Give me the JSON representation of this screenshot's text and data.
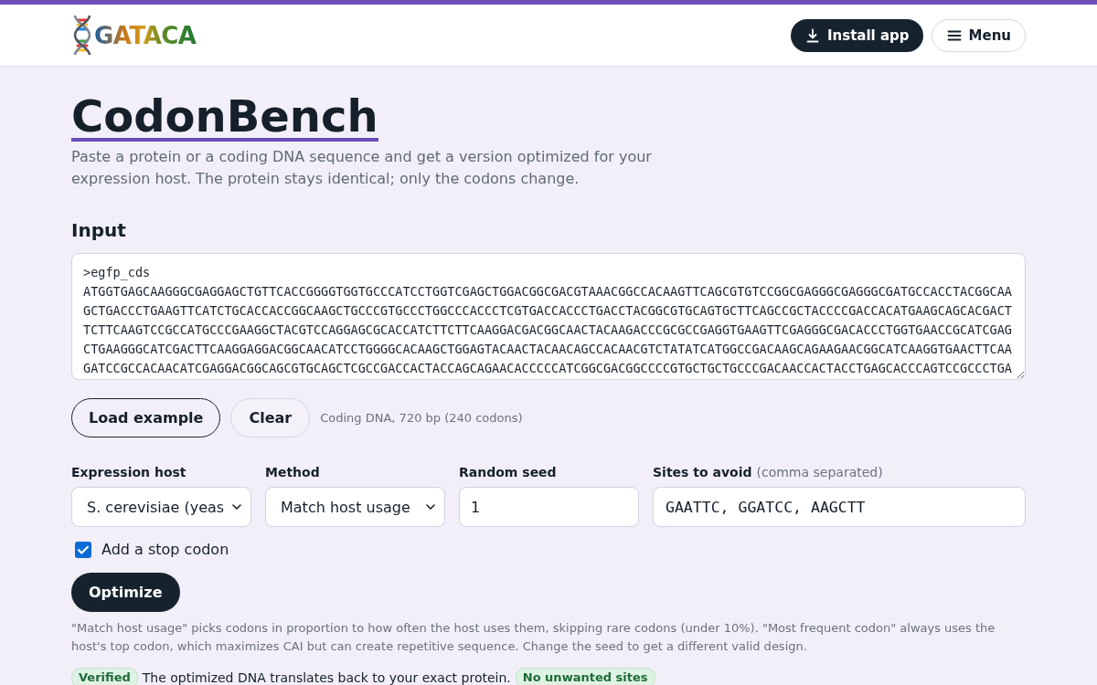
{
  "header": {
    "logo_text": "GATACA",
    "actions": [
      {
        "kind": "install",
        "label": "Install app"
      },
      {
        "kind": "menu",
        "label": "Menu"
      }
    ]
  },
  "title": "CodonBench",
  "intro": "Paste a protein or a coding DNA sequence and get a version optimized for your expression host. The protein stays identical; only the codons change.",
  "input": {
    "heading": "Input",
    "value": ">egfp_cds\nATGGTGAGCAAGGGCGAGGAGCTGTTCACCGGGGTGGTGCCCATCCTGGTCGAGCTGGACGGCGACGTAAACGGCCACAAGTTCAGCGTGTCCGGCGAGGGCGAGGGCGATGCCACCTACGGCAA\nGCTGACCCTGAAGTTCATCTGCACCACCGGCAAGCTGCCCGTGCCCTGGCCCACCCTCGTGACCACCCTGACCTACGGCGTGCAGTGCTTCAGCCGCTACCCCGACCACATGAAGCAGCACGACT\nTCTTCAAGTCCGCCATGCCCGAAGGCTACGTCCAGGAGCGCACCATCTTCTTCAAGGACGACGGCAACTACAAGACCCGCGCCGAGGTGAAGTTCGAGGGCGACACCCTGGTGAACCGCATCGAG\nCTGAAGGGCATCGACTTCAAGGAGGACGGCAACATCCTGGGGCACAAGCTGGAGTACAACTACAACAGCCACAACGTCTATATCATGGCCGACAAGCAGAAGAACGGCATCAAGGTGAACTTCAA\nGATCCGCCACAACATCGAGGACGGCAGCGTGCAGCTCGCCGACCACTACCAGCAGAACACCCCCATCGGCGACGGCCCCGTGCTGCTGCCCGACAACCACTACCTGAGCACCCAGTCCGCCCTGA",
    "buttons": [
      {
        "kind": "outline",
        "label": "Load example"
      },
      {
        "kind": "soft",
        "label": "Clear"
      }
    ],
    "status": "Coding DNA, 720 bp (240 codons)"
  },
  "settings": {
    "fields": [
      {
        "kind": "select",
        "label": "Expression host",
        "value": "S. cerevisiae (yeas"
      },
      {
        "kind": "select",
        "label": "Method",
        "value": "Match host usage"
      },
      {
        "kind": "number",
        "label": "Random seed",
        "value": "1"
      },
      {
        "kind": "sequence",
        "label": "Sites to avoid",
        "hint": "(comma separated)",
        "value": "GAATTC, GGATCC, AAGCTT"
      }
    ],
    "stop_codon": {
      "label": "Add a stop codon",
      "checked": true
    }
  },
  "optimize_button": "Optimize",
  "help": "\"Match host usage\" picks codons in proportion to how often the host uses them, skipping rare codons (under 10%). \"Most frequent codon\" always uses the host's top codon, which maximizes CAI but can create repetitive sequence. Change the seed to get a different valid design.",
  "result": [
    {
      "kind": "badge",
      "text": "Verified"
    },
    {
      "kind": "text",
      "text": "The optimized DNA translates back to your exact protein."
    },
    {
      "kind": "badge",
      "text": "No unwanted sites"
    }
  ]
}
